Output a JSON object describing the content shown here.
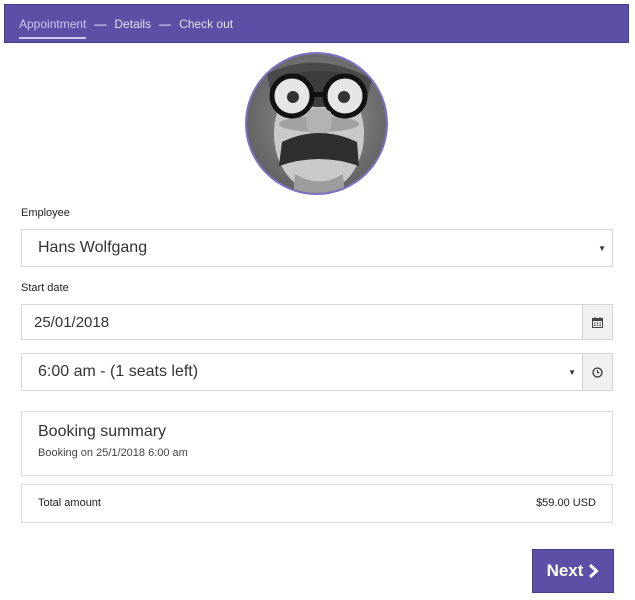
{
  "wizard": {
    "steps": [
      {
        "label": "Appointment",
        "active": true
      },
      {
        "label": "Details",
        "active": false
      },
      {
        "label": "Check out",
        "active": false
      }
    ],
    "separator": "—"
  },
  "colors": {
    "accent": "#5b4fa6",
    "accent_light": "#cfc8f3"
  },
  "employee": {
    "label": "Employee",
    "selected": "Hans Wolfgang"
  },
  "start_date": {
    "label": "Start date",
    "value": "25/01/2018",
    "icon": "calendar-icon"
  },
  "time_slot": {
    "selected": "6:00 am - (1 seats left)",
    "icon": "clock-icon"
  },
  "summary": {
    "title": "Booking summary",
    "detail": "Booking on 25/1/2018 6:00 am"
  },
  "total": {
    "label": "Total amount",
    "value": "$59.00 USD"
  },
  "next_button": {
    "label": "Next",
    "icon": "chevron-right-icon"
  }
}
